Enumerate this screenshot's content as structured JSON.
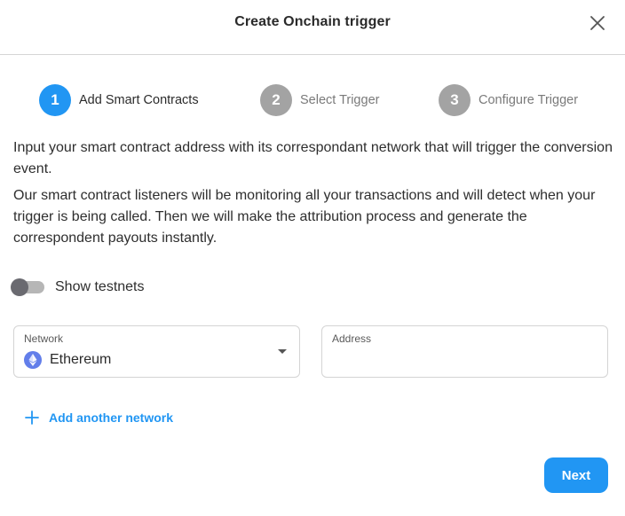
{
  "dialog": {
    "title": "Create Onchain trigger",
    "close_icon": "close-icon"
  },
  "stepper": {
    "steps": [
      {
        "number": "1",
        "label": "Add Smart Contracts",
        "state": "active"
      },
      {
        "number": "2",
        "label": "Select Trigger",
        "state": "inactive"
      },
      {
        "number": "3",
        "label": "Configure Trigger",
        "state": "inactive"
      }
    ]
  },
  "description": {
    "paragraph_1": "Input your smart contract address with its correspondant network that will trigger the conversion event.",
    "paragraph_2": "Our smart contract listeners will be monitoring all your transactions and will detect when your trigger is being called. Then we will make the attribution process and generate the correspondent payouts instantly."
  },
  "testnets_toggle": {
    "label": "Show testnets",
    "checked": false
  },
  "network_field": {
    "label": "Network",
    "value": "Ethereum",
    "icon": "ethereum-icon"
  },
  "address_field": {
    "label": "Address",
    "value": ""
  },
  "add_network": {
    "label": "Add another network",
    "icon": "plus-icon"
  },
  "actions": {
    "next_label": "Next"
  },
  "colors": {
    "primary": "#2196f3",
    "step_inactive": "#a3a3a3",
    "ethereum": "#627eea"
  }
}
